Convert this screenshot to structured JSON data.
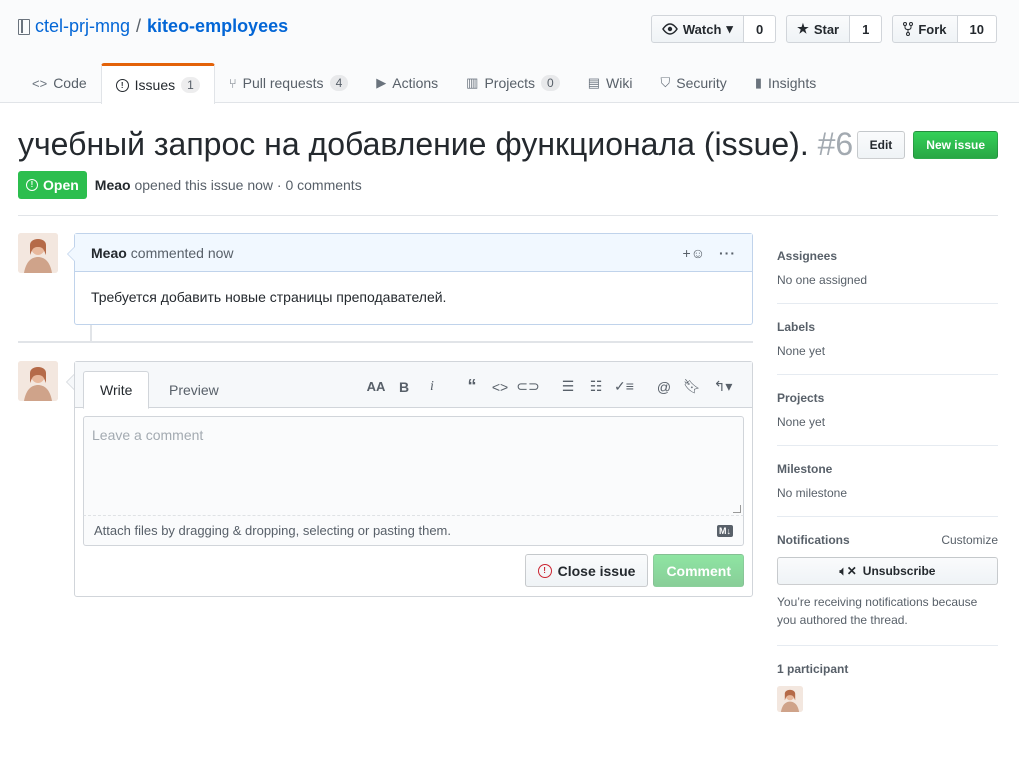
{
  "repo": {
    "owner": "ctel-prj-mng",
    "separator": "/",
    "name": "kiteo-employees"
  },
  "actions": {
    "watch_label": "Watch",
    "watch_count": "0",
    "star_label": "Star",
    "star_count": "1",
    "fork_label": "Fork",
    "fork_count": "10"
  },
  "tabs": [
    {
      "label": "Code",
      "icon": "code-icon"
    },
    {
      "label": "Issues",
      "count": "1",
      "icon": "issue-icon",
      "selected": true
    },
    {
      "label": "Pull requests",
      "count": "4",
      "icon": "pull-request-icon"
    },
    {
      "label": "Actions",
      "icon": "play-icon"
    },
    {
      "label": "Projects",
      "count": "0",
      "icon": "project-icon"
    },
    {
      "label": "Wiki",
      "icon": "book-icon"
    },
    {
      "label": "Security",
      "icon": "shield-icon"
    },
    {
      "label": "Insights",
      "icon": "graph-icon"
    }
  ],
  "issue": {
    "title": "учебный запрос на добавление функционала (issue).",
    "number": "#6",
    "edit_label": "Edit",
    "new_issue_label": "New issue",
    "state": "Open",
    "author": "Meao",
    "meta": "opened this issue now · 0 comments"
  },
  "comment": {
    "author": "Meao",
    "time": "commented now",
    "body": "Требуется добавить новые страницы преподавателей."
  },
  "editor": {
    "tab_write": "Write",
    "tab_preview": "Preview",
    "placeholder": "Leave a comment",
    "attach_hint": "Attach files by dragging & dropping, selecting or pasting them.",
    "close_label": "Close issue",
    "comment_label": "Comment"
  },
  "sidebar": {
    "assignees_title": "Assignees",
    "assignees_value": "No one assigned",
    "labels_title": "Labels",
    "labels_value": "None yet",
    "projects_title": "Projects",
    "projects_value": "None yet",
    "milestone_title": "Milestone",
    "milestone_value": "No milestone",
    "notifications_title": "Notifications",
    "customize_label": "Customize",
    "unsubscribe_label": "Unsubscribe",
    "reason": "You’re receiving notifications because you authored the thread.",
    "participants_title": "1 participant"
  },
  "colors": {
    "link": "#0366d6",
    "open_state": "#2cbe4e",
    "primary_button": "#28a745",
    "tab_accent": "#e36209"
  }
}
